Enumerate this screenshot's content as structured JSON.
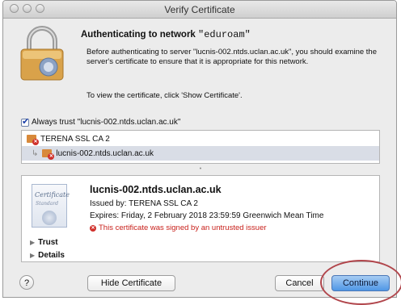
{
  "window": {
    "title": "Verify Certificate"
  },
  "dialog": {
    "heading_prefix": "Authenticating to network ",
    "network_name": "\"eduroam\"",
    "message": "Before authenticating to server \"lucnis-002.ntds.uclan.ac.uk\", you should examine the server's certificate to ensure that it is appropriate for this network.",
    "instruction": "To view the certificate, click 'Show Certificate'."
  },
  "always_trust": {
    "checked": true,
    "label": "Always trust \"lucnis-002.ntds.uclan.ac.uk\""
  },
  "cert_chain": [
    {
      "label": "TERENA SSL CA 2",
      "icon": "certificate-error-icon"
    },
    {
      "label": "lucnis-002.ntds.uclan.ac.uk",
      "icon": "certificate-error-icon"
    }
  ],
  "certificate": {
    "badge_title": "Certificate",
    "badge_subtitle": "Standard",
    "common_name": "lucnis-002.ntds.uclan.ac.uk",
    "issued_by": "Issued by: TERENA SSL CA 2",
    "expires": "Expires: Friday, 2 February 2018 23:59:59 Greenwich Mean Time",
    "warning": "This certificate was signed by an untrusted issuer",
    "sections": [
      "Trust",
      "Details"
    ]
  },
  "buttons": {
    "help": "?",
    "hide_certificate": "Hide Certificate",
    "cancel": "Cancel",
    "continue": "Continue"
  },
  "colors": {
    "warning": "#c8201b",
    "primary_button": "#4f97e6",
    "annotation_circle": "#b1464c"
  }
}
